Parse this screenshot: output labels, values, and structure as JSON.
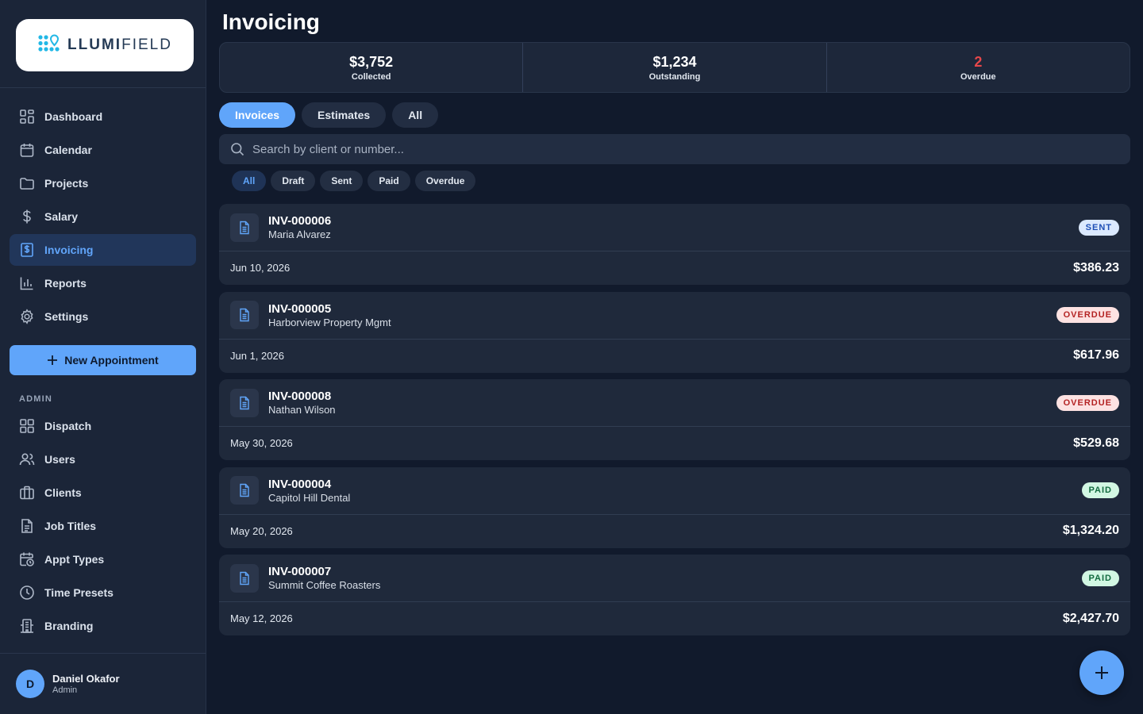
{
  "brand": {
    "name_bold": "LLUMI",
    "name_light": "FIELD"
  },
  "colors": {
    "accent": "#60a5fa",
    "sent_badge": "#dbe9fe",
    "overdue_badge": "#fde2e2",
    "paid_badge": "#d2f7e3",
    "overdue_stat": "#e5474a"
  },
  "sidebar": {
    "items": [
      {
        "label": "Dashboard",
        "icon": "grid-icon"
      },
      {
        "label": "Calendar",
        "icon": "calendar-icon"
      },
      {
        "label": "Projects",
        "icon": "folder-icon"
      },
      {
        "label": "Salary",
        "icon": "dollar-icon"
      },
      {
        "label": "Invoicing",
        "icon": "invoice-icon",
        "active": true
      },
      {
        "label": "Reports",
        "icon": "bar-chart-icon"
      },
      {
        "label": "Settings",
        "icon": "gear-icon"
      }
    ],
    "new_appointment_label": "New Appointment",
    "admin_label": "ADMIN",
    "admin_items": [
      {
        "label": "Dispatch",
        "icon": "grid-icon"
      },
      {
        "label": "Users",
        "icon": "users-icon"
      },
      {
        "label": "Clients",
        "icon": "briefcase-icon"
      },
      {
        "label": "Job Titles",
        "icon": "document-icon"
      },
      {
        "label": "Appt Types",
        "icon": "calendar-clock-icon"
      },
      {
        "label": "Time Presets",
        "icon": "clock-icon"
      },
      {
        "label": "Branding",
        "icon": "building-icon"
      }
    ],
    "user": {
      "initial": "D",
      "name": "Daniel Okafor",
      "role": "Admin"
    }
  },
  "main": {
    "title": "Invoicing",
    "stats": [
      {
        "value": "$3,752",
        "label": "Collected"
      },
      {
        "value": "$1,234",
        "label": "Outstanding"
      },
      {
        "value": "2",
        "label": "Overdue"
      }
    ],
    "tabs": [
      {
        "label": "Invoices",
        "active": true
      },
      {
        "label": "Estimates"
      },
      {
        "label": "All"
      }
    ],
    "search": {
      "placeholder": "Search by client or number..."
    },
    "filters": [
      {
        "label": "All",
        "active": true
      },
      {
        "label": "Draft"
      },
      {
        "label": "Sent"
      },
      {
        "label": "Paid"
      },
      {
        "label": "Overdue"
      }
    ],
    "invoices": [
      {
        "number": "INV-000006",
        "client": "Maria Alvarez",
        "status": "SENT",
        "date": "Jun 10, 2026",
        "amount": "$386.23"
      },
      {
        "number": "INV-000005",
        "client": "Harborview Property Mgmt",
        "status": "OVERDUE",
        "date": "Jun 1, 2026",
        "amount": "$617.96"
      },
      {
        "number": "INV-000008",
        "client": "Nathan Wilson",
        "status": "OVERDUE",
        "date": "May 30, 2026",
        "amount": "$529.68"
      },
      {
        "number": "INV-000004",
        "client": "Capitol Hill Dental",
        "status": "PAID",
        "date": "May 20, 2026",
        "amount": "$1,324.20"
      },
      {
        "number": "INV-000007",
        "client": "Summit Coffee Roasters",
        "status": "PAID",
        "date": "May 12, 2026",
        "amount": "$2,427.70"
      }
    ]
  }
}
